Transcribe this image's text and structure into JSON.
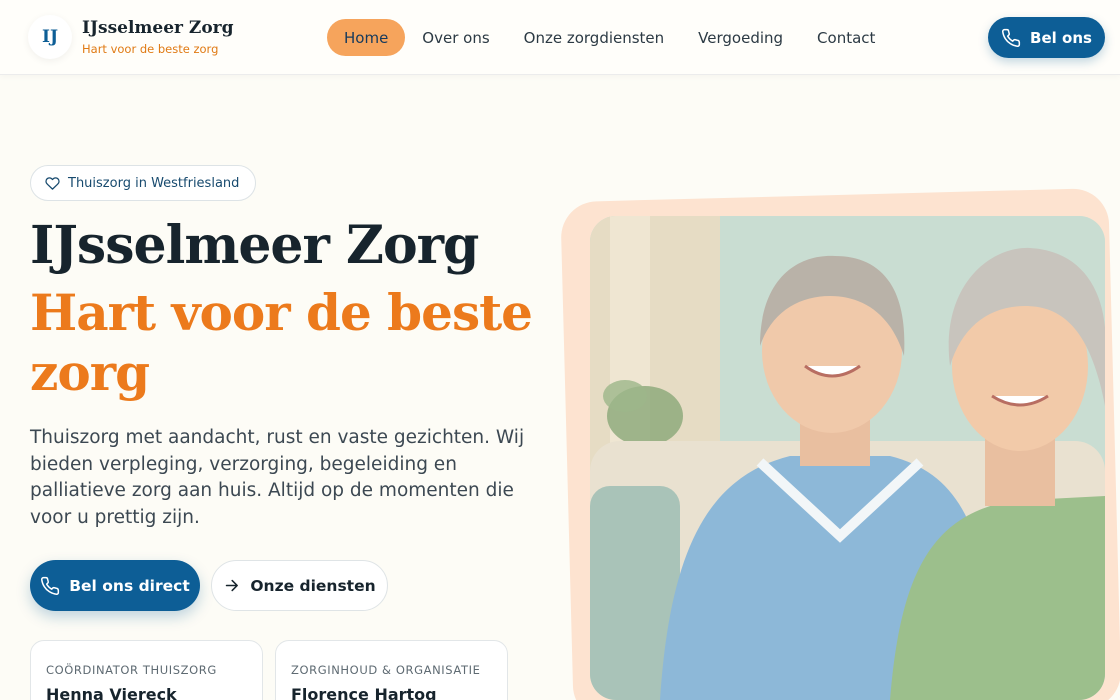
{
  "header": {
    "logo_mark": "IJ",
    "brand_name": "IJsselmeer Zorg",
    "brand_tagline": "Hart voor de beste zorg",
    "nav": [
      {
        "label": "Home",
        "active": true
      },
      {
        "label": "Over ons",
        "active": false
      },
      {
        "label": "Onze zorgdiensten",
        "active": false
      },
      {
        "label": "Vergoeding",
        "active": false
      },
      {
        "label": "Contact",
        "active": false
      }
    ],
    "call_button": "Bel ons"
  },
  "hero": {
    "pill": "Thuiszorg in Westfriesland",
    "title_line1": "IJsselmeer Zorg",
    "title_line2": "Hart voor de beste zorg",
    "lead": "Thuiszorg met aandacht, rust en vaste gezichten. Wij bieden verpleging, verzorging, begeleiding en palliatieve zorg aan huis. Altijd op de momenten die voor u prettig zijn.",
    "primary_button": "Bel ons direct",
    "secondary_button": "Onze diensten",
    "cards": [
      {
        "role": "COÖRDINATOR THUISZORG",
        "name": "Henna Viereck"
      },
      {
        "role": "ZORGINHOUD & ORGANISATIE",
        "name": "Florence Hartog"
      }
    ],
    "image_icon": "photo-caregiver-and-elderly-woman"
  },
  "colors": {
    "primary": "#0d5e96",
    "accent": "#ec7a1c",
    "nav_active_bg": "#f6a45c",
    "background": "#fdfcf6"
  }
}
